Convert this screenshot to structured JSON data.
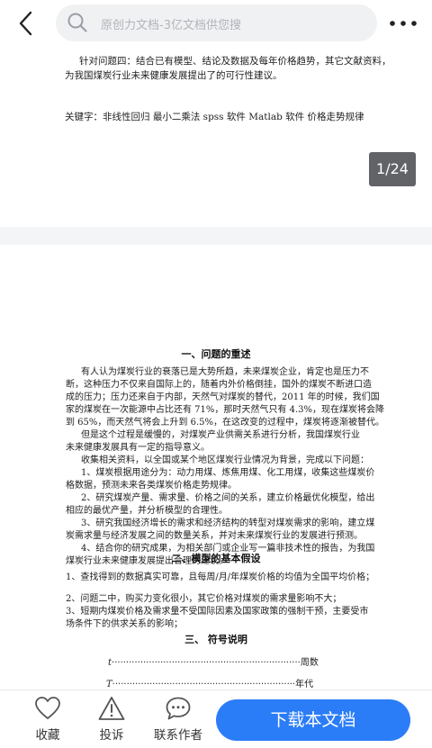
{
  "header": {
    "search_placeholder": "原创力文档-3亿文档供您搜"
  },
  "page1": {
    "lines": [
      "针对问题四：结合已有模型、结论及数据及每年价格趋势，其它文献资料，",
      "为我国煤炭行业未来健康发展提出了的可行性建议。",
      "关键字：非线性回归   最小二乘法   spss 软件   Matlab 软件  价格走势规律"
    ],
    "page_indicator": "1/24"
  },
  "page2": {
    "section1_title": "一、问题的重述",
    "section1_lines": [
      "有人认为煤炭行业的衰落已是大势所趋，未来煤炭企业，肯定也是压力不",
      "断，这种压力不仅来自国际上的，随着内外价格倒挂，国外的煤炭不断进口造",
      "成的压力；压力还来自于内部，天然气对煤炭的替代，2011 年的时候，我们国",
      "家的煤炭在一次能源中占比还有 71%，那时天然气只有 4.3%，现在煤炭将会降",
      "到 65%，而天然气将会上升到 6.5%，在这改变的过程中，煤炭将逐渐被替代。",
      "但是这个过程是缓慢的，对煤炭产业供需关系进行分析，我国煤炭行业",
      "未来健康发展具有一定的指导意义。",
      "收集相关资料，以全国或某个地区煤炭行业情况为背景，完成以下问题：",
      "1、煤炭根据用途分为：动力用煤、炼焦用煤、化工用煤，收集这些煤炭价",
      "格数据，预测未来各类煤炭价格走势规律。",
      "2、研究煤炭产量、需求量、价格之间的关系，建立价格最优化模型，给出",
      "相应的最优产量，并分析模型的合理性。",
      "3、研究我国经济增长的需求和经济结构的转型对煤炭需求的影响，建立煤",
      "炭需求量与经济发展之间的数量关系，并对未来煤炭行业的发展进行预测。",
      "4、结合你的研究成果，为相关部门或企业写一篇非技术性的报告，为我国",
      "煤炭行业未来健康发展提出合理的建议。"
    ],
    "section2_title": "二、模型的基本假设",
    "section2_lines": [
      "1、查找得到的数据真实可靠，且每周/月/年煤炭价格的均值为全国平均价格；",
      "2、问题二中，购买力变化很小，其它价格对煤炭的需求量影响不大；",
      "3、短期内煤炭价格及需求量不受国际因素及国家政策的强制干预，主要受市",
      "场条件下的供求关系的影响；"
    ],
    "section3_title": "三、  符号说明",
    "symbols": [
      {
        "sym": "t",
        "dots": "··································································",
        "meaning": "周数"
      },
      {
        "sym": "T",
        "dots": "································································",
        "meaning": "年代"
      }
    ]
  },
  "bottom": {
    "favorite_label": "收藏",
    "complain_label": "投诉",
    "contact_label": "联系作者",
    "download_label": "下载本文档"
  },
  "colors": {
    "accent": "#2b7cf7",
    "badge_bg": "#616366",
    "search_bg": "#f0f1f3",
    "gap_bg": "#f4f5f7"
  }
}
